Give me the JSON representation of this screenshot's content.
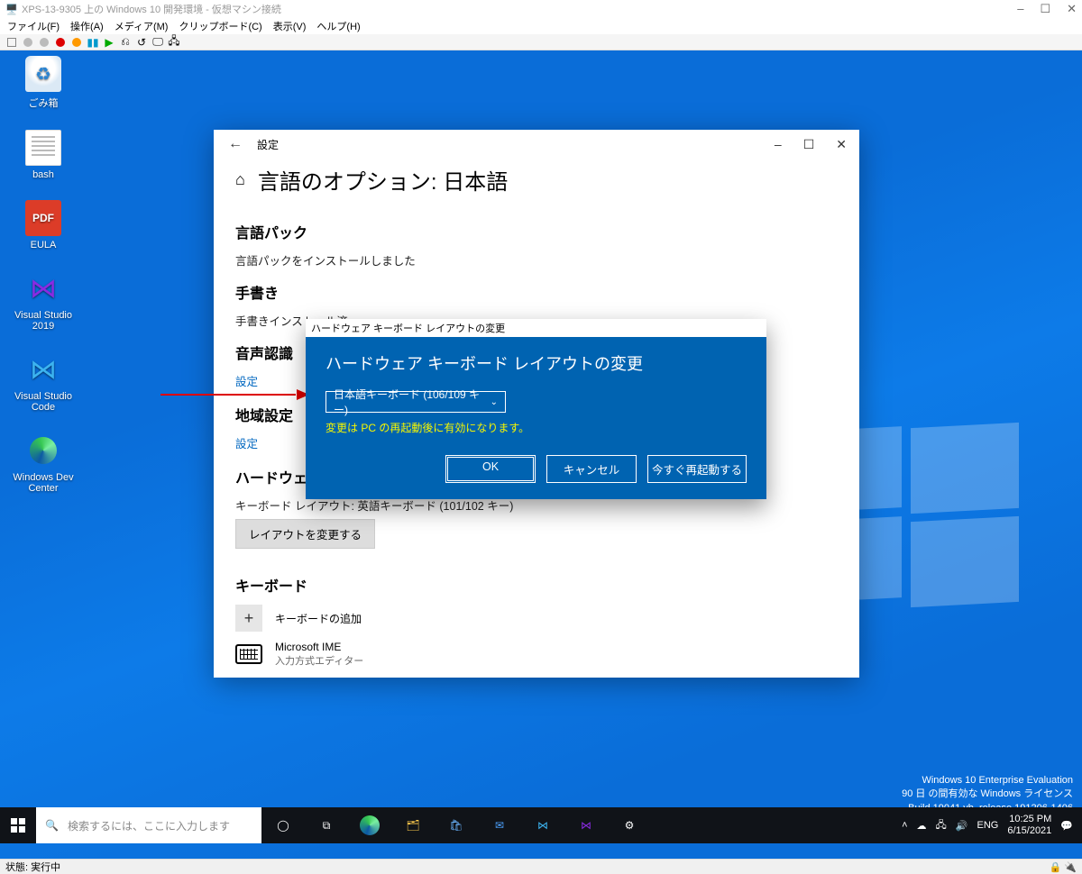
{
  "host": {
    "title": "XPS-13-9305 上の Windows 10 開発環境  - 仮想マシン接続",
    "menu": [
      "ファイル(F)",
      "操作(A)",
      "メディア(M)",
      "クリップボード(C)",
      "表示(V)",
      "ヘルプ(H)"
    ],
    "status": "状態: 実行中",
    "winctl_min": "–",
    "winctl_max": "☐",
    "winctl_close": "✕"
  },
  "desktop": {
    "icons": [
      {
        "label": "ごみ箱",
        "kind": "recycle"
      },
      {
        "label": "bash",
        "kind": "text"
      },
      {
        "label": "EULA",
        "kind": "pdf",
        "badge": "PDF"
      },
      {
        "label": "Visual Studio 2019",
        "kind": "vs-purple",
        "glyph": "⋈"
      },
      {
        "label": "Visual Studio Code",
        "kind": "vs-blue",
        "glyph": "⋈"
      },
      {
        "label": "Windows Dev Center",
        "kind": "edge"
      }
    ],
    "watermark": [
      "Windows 10 Enterprise Evaluation",
      "90 日 の間有効な Windows ライセンス",
      "Build 19041.vb_release.191206-1406"
    ]
  },
  "taskbar": {
    "search_placeholder": "検索するには、ここに入力します",
    "tray_lang": "ENG",
    "time": "10:25 PM",
    "date": "6/15/2021"
  },
  "settings": {
    "window_label": "設定",
    "back_glyph": "←",
    "home_glyph": "⌂",
    "title": "言語のオプション: 日本語",
    "sections": {
      "lang_pack_h": "言語パック",
      "lang_pack_txt": "言語パックをインストールしました",
      "handwriting_h": "手書き",
      "handwriting_txt": "手書きインストール済",
      "speech_h": "音声認識",
      "speech_link": "設定",
      "region_h": "地域設定",
      "region_link": "設定",
      "hw_kb_h": "ハードウェア キーボード レイアウト",
      "hw_kb_txt": "キーボード レイアウト:  英語キーボード (101/102 キー)",
      "hw_kb_btn": "レイアウトを変更する",
      "kb_h": "キーボード",
      "add_kb": "キーボードの追加",
      "ime_name": "Microsoft IME",
      "ime_sub": "入力方式エディター"
    },
    "winctl_min": "–",
    "winctl_max": "☐",
    "winctl_close": "✕"
  },
  "dialog": {
    "titlebar": "ハードウェア キーボード レイアウトの変更",
    "heading": "ハードウェア キーボード レイアウトの変更",
    "combo_value": "日本語キーボード (106/109 キー)",
    "chev": "⌄",
    "warning": "変更は PC の再起動後に有効になります。",
    "ok": "OK",
    "cancel": "キャンセル",
    "restart": "今すぐ再起動する"
  }
}
